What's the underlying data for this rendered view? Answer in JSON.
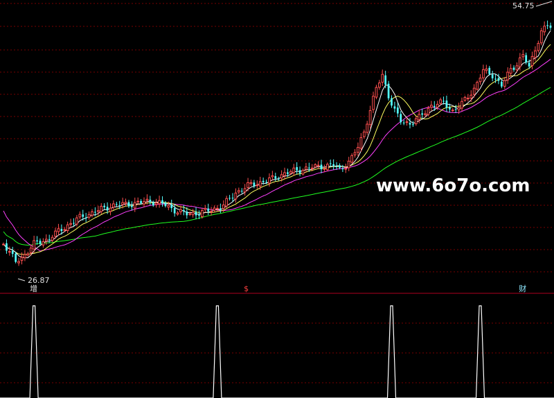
{
  "watermark": "www.6o7o.com",
  "colors": {
    "background": "#000000",
    "grid": "#7a0000",
    "separator": "#b00020",
    "up": "#ff5050",
    "down": "#54ffff",
    "ma_fast": "#ffffff",
    "ma_mid": "#ffff60",
    "ma_slow": "#ff40ff",
    "ma_long": "#20ff20",
    "signal": "#ffffff",
    "label_text": "#e0e0e0"
  },
  "chart_data": [
    {
      "type": "candlestick",
      "ylim": [
        26.87,
        54.75
      ],
      "high_label": "54.75",
      "low_label": "26.87",
      "grid": true,
      "markers": [
        {
          "text": "增",
          "x": 10,
          "color": "#e0e0e0"
        },
        {
          "text": "$",
          "x": 80,
          "color": "#ff4040"
        },
        {
          "text": "财",
          "x": 170,
          "color": "#8fe8ff"
        }
      ]
    },
    {
      "type": "line",
      "ylim": [
        0,
        1
      ],
      "series": [
        {
          "spikes_at": [
            10,
            70,
            127,
            156
          ]
        }
      ]
    }
  ]
}
